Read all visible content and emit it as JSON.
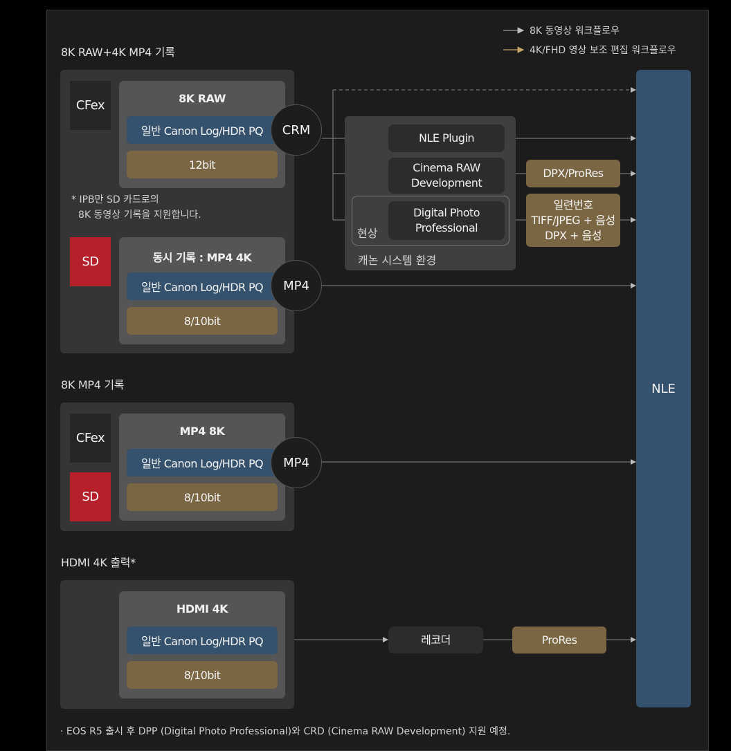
{
  "legend": {
    "items": [
      {
        "label": "8K 동영상 워크플로우",
        "color": "#9a9a9a"
      },
      {
        "label": "4K/FHD 영상 보조 편집 워크플로우",
        "color": "#c9a56a"
      }
    ]
  },
  "sections": {
    "raw_mp4": {
      "title": "8K RAW+4K MP4 기록",
      "media_cfex": "CFex",
      "media_sd": "SD",
      "raw_card": {
        "title": "8K RAW",
        "profile": "일반 Canon Log/HDR PQ",
        "bit": "12bit",
        "format": "CRM"
      },
      "note_line1": "* IPB만 SD 카드로의",
      "note_line2": "8K 동영상 기록을 지원합니다.",
      "mp4_card": {
        "title": "동시 기록 : MP4 4K",
        "profile": "일반 Canon Log/HDR PQ",
        "bit": "8/10bit",
        "format": "MP4"
      }
    },
    "mp4_8k": {
      "title": "8K MP4 기록",
      "media_cfex": "CFex",
      "media_sd": "SD",
      "card": {
        "title": "MP4 8K",
        "profile": "일반 Canon Log/HDR PQ",
        "bit": "8/10bit",
        "format": "MP4"
      }
    },
    "hdmi": {
      "title": "HDMI 4K 출력*",
      "card": {
        "title": "HDMI 4K",
        "profile": "일반 Canon Log/HDR PQ",
        "bit": "8/10bit"
      },
      "recorder": "레코더",
      "prores": "ProRes"
    }
  },
  "canon_system": {
    "label": "캐논 시스템 환경",
    "develop_label": "현상",
    "nle_plugin": "NLE Plugin",
    "cinema_raw": "Cinema RAW\nDevelopment",
    "dpp": "Digital Photo\nProfessional"
  },
  "outputs": {
    "dpx_prores": "DPX/ProRes",
    "serial": "일련번호\nTIFF/JPEG + 음성\nDPX + 음성"
  },
  "nle": "NLE",
  "footnote": "· EOS R5 출시 후 DPP (Digital Photo Professional)와 CRD (Cinema RAW Development) 지원 예정.",
  "colors": {
    "blue": "#34516d",
    "gold": "#7a6642",
    "sd_red": "#b5202a"
  }
}
